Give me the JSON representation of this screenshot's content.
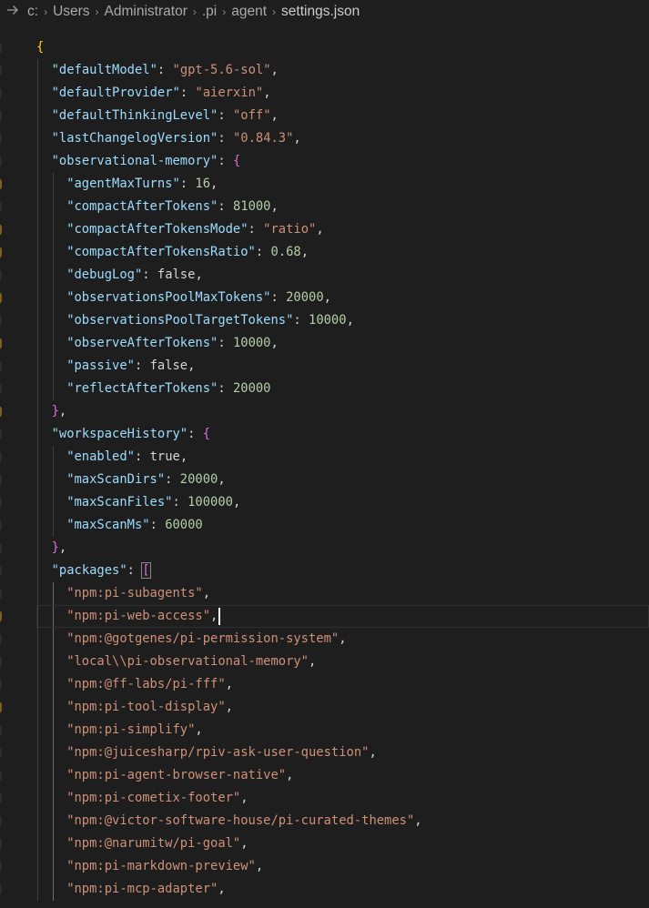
{
  "breadcrumb": {
    "arrow_icon": "arrow-right-icon",
    "segments": [
      "c:",
      "Users",
      "Administrator",
      ".pi",
      "agent",
      "settings.json"
    ]
  },
  "editor": {
    "language": "json",
    "current_line": 26,
    "lines": [
      {
        "indent": 0,
        "tokens": [
          {
            "t": "{",
            "c": "br1"
          }
        ]
      },
      {
        "indent": 1,
        "tokens": [
          {
            "t": "\"defaultModel\"",
            "c": "k"
          },
          {
            "t": ": ",
            "c": "p"
          },
          {
            "t": "\"gpt-5.6-sol\"",
            "c": "s"
          },
          {
            "t": ",",
            "c": "p"
          }
        ]
      },
      {
        "indent": 1,
        "tokens": [
          {
            "t": "\"defaultProvider\"",
            "c": "k"
          },
          {
            "t": ": ",
            "c": "p"
          },
          {
            "t": "\"aierxin\"",
            "c": "s"
          },
          {
            "t": ",",
            "c": "p"
          }
        ]
      },
      {
        "indent": 1,
        "tokens": [
          {
            "t": "\"defaultThinkingLevel\"",
            "c": "k"
          },
          {
            "t": ": ",
            "c": "p"
          },
          {
            "t": "\"off\"",
            "c": "s"
          },
          {
            "t": ",",
            "c": "p"
          }
        ]
      },
      {
        "indent": 1,
        "tokens": [
          {
            "t": "\"lastChangelogVersion\"",
            "c": "k"
          },
          {
            "t": ": ",
            "c": "p"
          },
          {
            "t": "\"0.84.3\"",
            "c": "s"
          },
          {
            "t": ",",
            "c": "p"
          }
        ]
      },
      {
        "indent": 1,
        "tokens": [
          {
            "t": "\"observational-memory\"",
            "c": "k"
          },
          {
            "t": ": ",
            "c": "p"
          },
          {
            "t": "{",
            "c": "br2"
          }
        ]
      },
      {
        "indent": 2,
        "tokens": [
          {
            "t": "\"agentMaxTurns\"",
            "c": "k"
          },
          {
            "t": ": ",
            "c": "p"
          },
          {
            "t": "16",
            "c": "n"
          },
          {
            "t": ",",
            "c": "p"
          }
        ]
      },
      {
        "indent": 2,
        "tokens": [
          {
            "t": "\"compactAfterTokens\"",
            "c": "k"
          },
          {
            "t": ": ",
            "c": "p"
          },
          {
            "t": "81000",
            "c": "n"
          },
          {
            "t": ",",
            "c": "p"
          }
        ]
      },
      {
        "indent": 2,
        "tokens": [
          {
            "t": "\"compactAfterTokensMode\"",
            "c": "k"
          },
          {
            "t": ": ",
            "c": "p"
          },
          {
            "t": "\"ratio\"",
            "c": "s"
          },
          {
            "t": ",",
            "c": "p"
          }
        ]
      },
      {
        "indent": 2,
        "tokens": [
          {
            "t": "\"compactAfterTokensRatio\"",
            "c": "k"
          },
          {
            "t": ": ",
            "c": "p"
          },
          {
            "t": "0.68",
            "c": "n"
          },
          {
            "t": ",",
            "c": "p"
          }
        ]
      },
      {
        "indent": 2,
        "tokens": [
          {
            "t": "\"debugLog\"",
            "c": "k"
          },
          {
            "t": ": ",
            "c": "p"
          },
          {
            "t": "false",
            "c": "b"
          },
          {
            "t": ",",
            "c": "p"
          }
        ]
      },
      {
        "indent": 2,
        "tokens": [
          {
            "t": "\"observationsPoolMaxTokens\"",
            "c": "k"
          },
          {
            "t": ": ",
            "c": "p"
          },
          {
            "t": "20000",
            "c": "n"
          },
          {
            "t": ",",
            "c": "p"
          }
        ]
      },
      {
        "indent": 2,
        "tokens": [
          {
            "t": "\"observationsPoolTargetTokens\"",
            "c": "k"
          },
          {
            "t": ": ",
            "c": "p"
          },
          {
            "t": "10000",
            "c": "n"
          },
          {
            "t": ",",
            "c": "p"
          }
        ]
      },
      {
        "indent": 2,
        "tokens": [
          {
            "t": "\"observeAfterTokens\"",
            "c": "k"
          },
          {
            "t": ": ",
            "c": "p"
          },
          {
            "t": "10000",
            "c": "n"
          },
          {
            "t": ",",
            "c": "p"
          }
        ]
      },
      {
        "indent": 2,
        "tokens": [
          {
            "t": "\"passive\"",
            "c": "k"
          },
          {
            "t": ": ",
            "c": "p"
          },
          {
            "t": "false",
            "c": "b"
          },
          {
            "t": ",",
            "c": "p"
          }
        ]
      },
      {
        "indent": 2,
        "tokens": [
          {
            "t": "\"reflectAfterTokens\"",
            "c": "k"
          },
          {
            "t": ": ",
            "c": "p"
          },
          {
            "t": "20000",
            "c": "n"
          }
        ]
      },
      {
        "indent": 1,
        "tokens": [
          {
            "t": "}",
            "c": "br2"
          },
          {
            "t": ",",
            "c": "p"
          }
        ]
      },
      {
        "indent": 1,
        "tokens": [
          {
            "t": "\"workspaceHistory\"",
            "c": "k"
          },
          {
            "t": ": ",
            "c": "p"
          },
          {
            "t": "{",
            "c": "br2"
          }
        ]
      },
      {
        "indent": 2,
        "tokens": [
          {
            "t": "\"enabled\"",
            "c": "k"
          },
          {
            "t": ": ",
            "c": "p"
          },
          {
            "t": "true",
            "c": "b"
          },
          {
            "t": ",",
            "c": "p"
          }
        ]
      },
      {
        "indent": 2,
        "tokens": [
          {
            "t": "\"maxScanDirs\"",
            "c": "k"
          },
          {
            "t": ": ",
            "c": "p"
          },
          {
            "t": "20000",
            "c": "n"
          },
          {
            "t": ",",
            "c": "p"
          }
        ]
      },
      {
        "indent": 2,
        "tokens": [
          {
            "t": "\"maxScanFiles\"",
            "c": "k"
          },
          {
            "t": ": ",
            "c": "p"
          },
          {
            "t": "100000",
            "c": "n"
          },
          {
            "t": ",",
            "c": "p"
          }
        ]
      },
      {
        "indent": 2,
        "tokens": [
          {
            "t": "\"maxScanMs\"",
            "c": "k"
          },
          {
            "t": ": ",
            "c": "p"
          },
          {
            "t": "60000",
            "c": "n"
          }
        ]
      },
      {
        "indent": 1,
        "tokens": [
          {
            "t": "}",
            "c": "br2"
          },
          {
            "t": ",",
            "c": "p"
          }
        ]
      },
      {
        "indent": 1,
        "tokens": [
          {
            "t": "\"packages\"",
            "c": "k"
          },
          {
            "t": ": ",
            "c": "p"
          },
          {
            "t": "[",
            "c": "br2",
            "match": true
          }
        ]
      },
      {
        "indent": 2,
        "tokens": [
          {
            "t": "\"npm:pi-subagents\"",
            "c": "s"
          },
          {
            "t": ",",
            "c": "p"
          }
        ]
      },
      {
        "indent": 2,
        "tokens": [
          {
            "t": "\"npm:pi-web-access\"",
            "c": "s"
          },
          {
            "t": ",",
            "c": "p"
          }
        ],
        "cursor": true
      },
      {
        "indent": 2,
        "tokens": [
          {
            "t": "\"npm:@gotgenes/pi-permission-system\"",
            "c": "s"
          },
          {
            "t": ",",
            "c": "p"
          }
        ]
      },
      {
        "indent": 2,
        "tokens": [
          {
            "t": "\"local\\\\pi-observational-memory\"",
            "c": "s"
          },
          {
            "t": ",",
            "c": "p"
          }
        ]
      },
      {
        "indent": 2,
        "tokens": [
          {
            "t": "\"npm:@ff-labs/pi-fff\"",
            "c": "s"
          },
          {
            "t": ",",
            "c": "p"
          }
        ]
      },
      {
        "indent": 2,
        "tokens": [
          {
            "t": "\"npm:pi-tool-display\"",
            "c": "s"
          },
          {
            "t": ",",
            "c": "p"
          }
        ]
      },
      {
        "indent": 2,
        "tokens": [
          {
            "t": "\"npm:pi-simplify\"",
            "c": "s"
          },
          {
            "t": ",",
            "c": "p"
          }
        ]
      },
      {
        "indent": 2,
        "tokens": [
          {
            "t": "\"npm:@juicesharp/rpiv-ask-user-question\"",
            "c": "s"
          },
          {
            "t": ",",
            "c": "p"
          }
        ]
      },
      {
        "indent": 2,
        "tokens": [
          {
            "t": "\"npm:pi-agent-browser-native\"",
            "c": "s"
          },
          {
            "t": ",",
            "c": "p"
          }
        ]
      },
      {
        "indent": 2,
        "tokens": [
          {
            "t": "\"npm:pi-cometix-footer\"",
            "c": "s"
          },
          {
            "t": ",",
            "c": "p"
          }
        ]
      },
      {
        "indent": 2,
        "tokens": [
          {
            "t": "\"npm:@victor-software-house/pi-curated-themes\"",
            "c": "s"
          },
          {
            "t": ",",
            "c": "p"
          }
        ]
      },
      {
        "indent": 2,
        "tokens": [
          {
            "t": "\"npm:@narumitw/pi-goal\"",
            "c": "s"
          },
          {
            "t": ",",
            "c": "p"
          }
        ]
      },
      {
        "indent": 2,
        "tokens": [
          {
            "t": "\"npm:pi-markdown-preview\"",
            "c": "s"
          },
          {
            "t": ",",
            "c": "p"
          }
        ]
      },
      {
        "indent": 2,
        "tokens": [
          {
            "t": "\"npm:pi-mcp-adapter\"",
            "c": "s"
          },
          {
            "t": ",",
            "c": "p"
          }
        ]
      }
    ]
  }
}
